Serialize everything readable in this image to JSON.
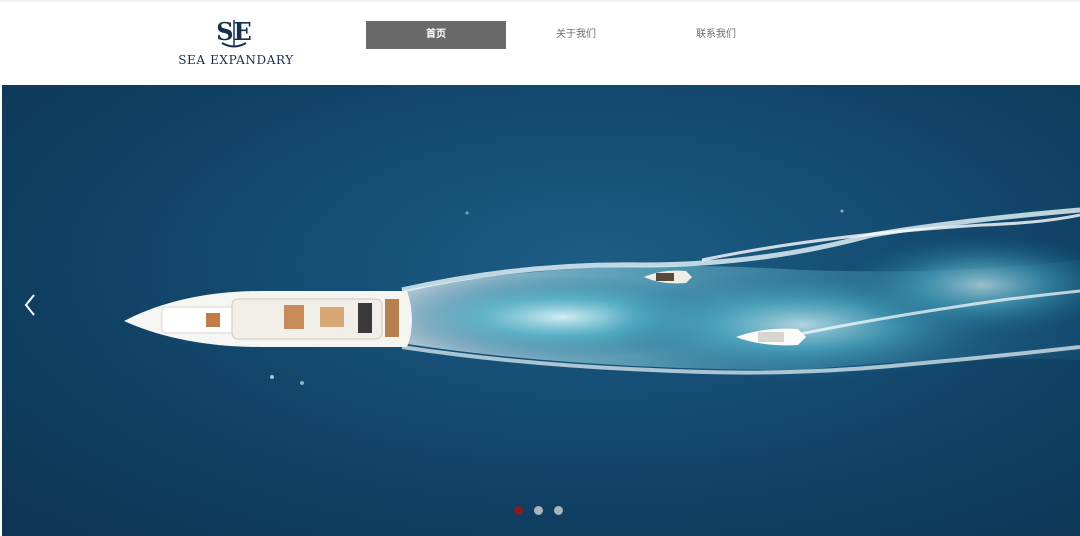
{
  "brand": {
    "logo_monogram": "SE",
    "name": "SEA EXPANDARY",
    "color": "#16304f"
  },
  "nav": {
    "items": [
      {
        "label": "首页",
        "active": true
      },
      {
        "label": "关于我们",
        "active": false
      },
      {
        "label": "联系我们",
        "active": false
      }
    ],
    "active_bg": "#6a6a6a"
  },
  "carousel": {
    "prev_icon": "chevron-left-icon",
    "slide_count": 3,
    "active_slide": 1,
    "active_dot_color": "#8a1c1c",
    "dot_color": "#a9b4bd",
    "image_description_icon": "yacht-photo"
  }
}
